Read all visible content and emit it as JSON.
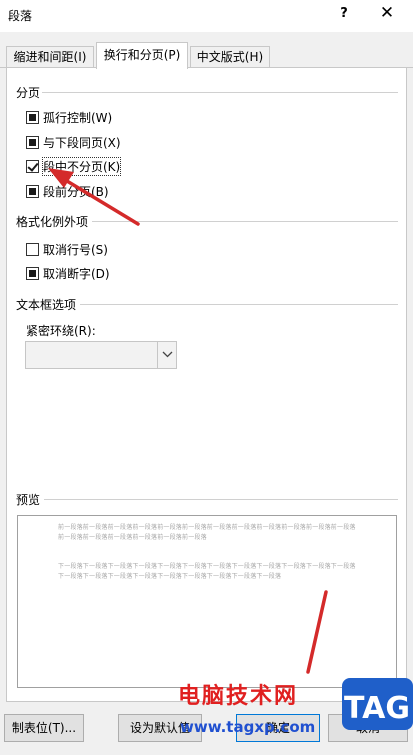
{
  "window": {
    "title": "段落",
    "help_glyph": "?",
    "close_glyph": "✕"
  },
  "tabs": [
    {
      "label": "缩进和间距(I)",
      "active": false
    },
    {
      "label": "换行和分页(P)",
      "active": true
    },
    {
      "label": "中文版式(H)",
      "active": false
    }
  ],
  "sections": {
    "pagination": "分页",
    "exceptions": "格式化例外项",
    "textbox": "文本框选项",
    "preview": "预览"
  },
  "checkboxes": [
    {
      "label": "孤行控制(W)",
      "state": "indeterminate"
    },
    {
      "label": "与下段同页(X)",
      "state": "indeterminate"
    },
    {
      "label": "段中不分页(K)",
      "state": "checked"
    },
    {
      "label": "段前分页(B)",
      "state": "indeterminate"
    },
    {
      "label": "取消行号(S)",
      "state": "unchecked"
    },
    {
      "label": "取消断字(D)",
      "state": "indeterminate"
    }
  ],
  "tight_wrap": {
    "label": "紧密环绕(R):",
    "value": ""
  },
  "preview": {
    "prev_text": "前一段落前一段落前一段落前一段落前一段落前一段落前一段落前一段落前一段落前一段落前一段落前一段落前一段落前一段落前一段落前一段落前一段落前一段落",
    "next_text": "下一段落下一段落下一段落下一段落下一段落下一段落下一段落下一段落下一段落下一段落下一段落下一段落下一段落下一段落下一段落下一段落下一段落下一段落下一段落下一段落下一段落"
  },
  "buttons": {
    "tabs": "制表位(T)...",
    "set_default": "设为默认值",
    "ok": "确定",
    "cancel": "取消"
  },
  "watermark": {
    "text": "电脑技术网",
    "url": "www.tagxp.com",
    "logo": "TAG"
  },
  "colors": {
    "accent": "#0078d7",
    "annotation": "#d42a2a",
    "watermark_red": "#e02020",
    "watermark_blue": "#2050d0",
    "logo_blue": "#1f5fc9"
  }
}
